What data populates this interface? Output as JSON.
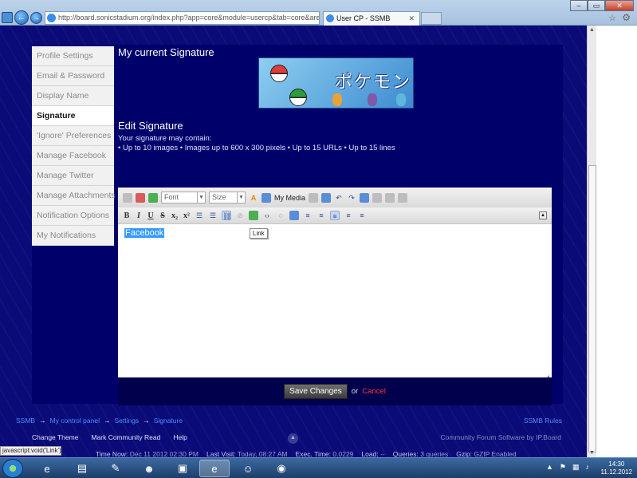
{
  "browser": {
    "url": "http://board.sonicstadium.org/index.php?app=core&module=usercp&tab=core&area=sig",
    "tab_title": "User CP - SSMB",
    "tab_close": "✕",
    "window_controls": [
      "–",
      "▭",
      "✕"
    ]
  },
  "sidebar": {
    "items": [
      {
        "label": "Profile Settings",
        "active": false
      },
      {
        "label": "Email & Password",
        "active": false
      },
      {
        "label": "Display Name",
        "active": false
      },
      {
        "label": "Signature",
        "active": true
      },
      {
        "label": "'Ignore' Preferences",
        "active": false
      },
      {
        "label": "Manage Facebook",
        "active": false
      },
      {
        "label": "Manage Twitter",
        "active": false
      },
      {
        "label": "Manage Attachments",
        "active": false
      },
      {
        "label": "Notification Options",
        "active": false
      },
      {
        "label": "My Notifications",
        "active": false
      }
    ]
  },
  "current_signature": {
    "title": "My current Signature",
    "image_text": "ポケモン"
  },
  "edit_signature": {
    "title": "Edit Signature",
    "intro": "Your signature may contain:",
    "rules": "• Up to 10 images  • Images up to 600 x 300 pixels  • Up to 15 URLs  • Up to 15 lines"
  },
  "editor": {
    "font_select": "Font",
    "size_select": "Size",
    "my_media": "My Media",
    "format_buttons": [
      "B",
      "I",
      "U",
      "S",
      "x₂",
      "x²"
    ],
    "content_text": "Facebook",
    "tooltip": "Link"
  },
  "actions": {
    "save_label": "Save Changes",
    "or_text": "or",
    "cancel_label": "Cancel"
  },
  "breadcrumb": [
    "SSMB",
    "My control panel",
    "Settings",
    "Signature"
  ],
  "breadcrumb_sep": "→",
  "rules_link": "SSMB Rules",
  "footer": {
    "links": [
      "Change Theme",
      "Mark Community Read",
      "Help"
    ],
    "powered_by": "Community Forum Software by IP.Board",
    "stats": [
      {
        "label": "Time Now:",
        "value": "Dec 11 2012 02:30 PM"
      },
      {
        "label": "Last Visit:",
        "value": "Today, 08:27 AM"
      },
      {
        "label": "Exec. Time:",
        "value": "0.0229"
      },
      {
        "label": "Load:",
        "value": "--"
      },
      {
        "label": "Queries:",
        "value": "3 queries"
      },
      {
        "label": "Gzip:",
        "value": "GZIP Enabled"
      }
    ]
  },
  "status_bar": "javascript:void('Link')",
  "taskbar": {
    "time": "14:30",
    "date": "11.12.2012"
  }
}
